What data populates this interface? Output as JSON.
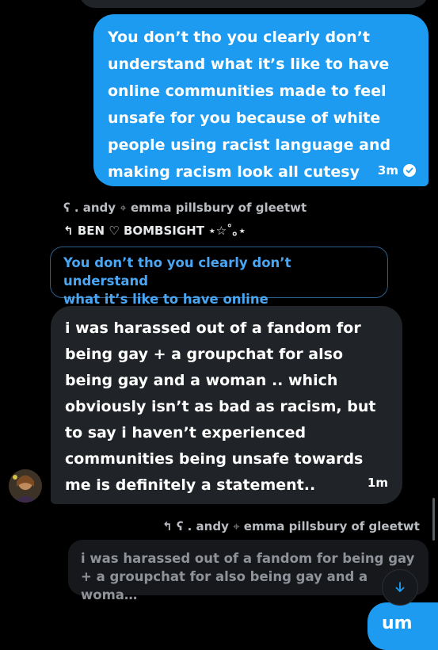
{
  "messages": {
    "sent": {
      "text": "You don’t tho you clearly don’t\nunderstand what it’s like to have\nonline communities made to feel\nunsafe for you because of white\npeople using racist language and\nmaking racism look all cutesy",
      "time": "3m"
    },
    "reply_header_1": {
      "name": "ʕ . andy",
      "separator": "⌖",
      "subtitle": "emma pillsbury of gleetwt"
    },
    "reply_header_2": {
      "arrow": "↰",
      "text": "BEN ♡ BOMBSIGHT ⋆☆˚｡⋆"
    },
    "quoted_1": "You don’t tho you clearly don’t understand\nwhat it’s like to have online communities…",
    "received": {
      "text": "i was harassed out of a fandom for\nbeing gay + a groupchat for also\nbeing gay and a woman .. which\nobviously isn’t as bad as racism, but\nto say i haven’t experienced\ncommunities being unsafe towards\nme is definitely a statement..",
      "time": "1m"
    },
    "reply_header_3": {
      "arrow": "↰",
      "name": "ʕ . andy",
      "separator": "⌖",
      "subtitle": "emma pillsbury of gleetwt"
    },
    "quoted_2": "i was harassed out of a fandom for being gay\n+ a groupchat for also being gay and a woma…",
    "bottom_partial": "um"
  },
  "colors": {
    "accent": "#1d9bf0",
    "background": "#000000",
    "bubble_gray": "#202327"
  }
}
